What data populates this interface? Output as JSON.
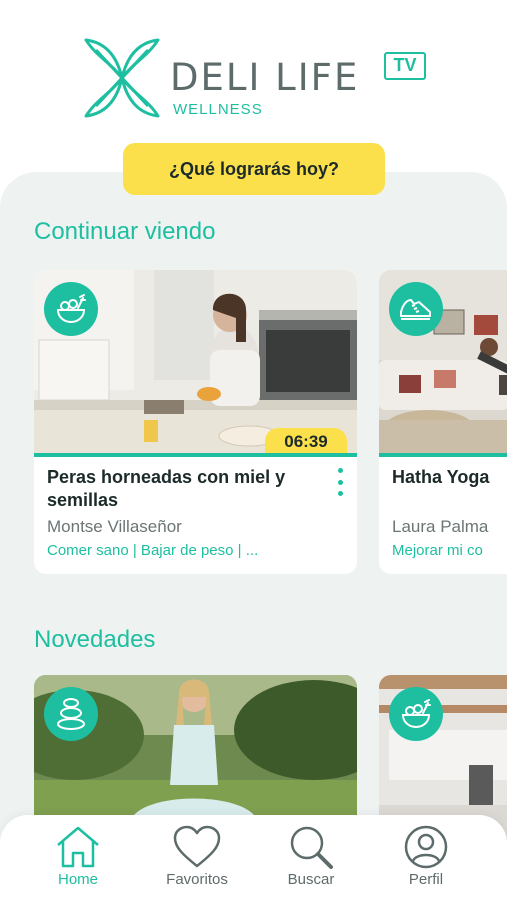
{
  "brand": {
    "name": "DELI LIFE",
    "tv": "TV",
    "subtitle": "WELLNESS"
  },
  "cta": {
    "label": "¿Qué lograrás hoy?"
  },
  "colors": {
    "accent": "#1dbfa0",
    "yellow": "#fbe04c",
    "background": "#eef3f2"
  },
  "continue_watching": {
    "title": "Continuar viendo",
    "items": [
      {
        "icon": "salad-bowl-icon",
        "title": "Peras horneadas con miel y semillas",
        "author": "Montse Villaseñor",
        "tags": "Comer sano | Bajar de peso | ...",
        "duration": "06:39"
      },
      {
        "icon": "sneaker-icon",
        "title": "Hatha Yoga",
        "author": "Laura Palma",
        "tags": "Mejorar mi co"
      }
    ]
  },
  "new_releases": {
    "title": "Novedades",
    "items": [
      {
        "icon": "stones-icon"
      },
      {
        "icon": "salad-bowl-icon"
      }
    ]
  },
  "nav": {
    "items": [
      {
        "label": "Home",
        "icon": "home-icon",
        "active": true
      },
      {
        "label": "Favoritos",
        "icon": "heart-icon"
      },
      {
        "label": "Buscar",
        "icon": "search-icon"
      },
      {
        "label": "Perfil",
        "icon": "profile-icon"
      }
    ]
  }
}
